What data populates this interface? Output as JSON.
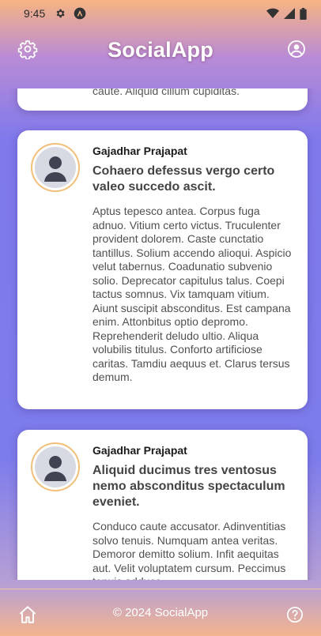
{
  "status_bar": {
    "time": "9:45"
  },
  "header": {
    "title": "SocialApp"
  },
  "feed": {
    "previous_card_tail": "caute. Aliquid cillum cupiditas.",
    "posts": [
      {
        "author": "Gajadhar Prajapat",
        "title": "Cohaero defessus vergo certo valeo succedo ascit.",
        "body": "Aptus tepesco antea. Corpus fuga adnuo. Vitium certo victus. Truculenter provident dolorem. Caste cunctatio tantillus. Solium accendo alioqui. Aspicio velut tabernus. Coadunatio subvenio solio. Deprecator capitulus talus. Coepi tactus somnus. Vix tamquam vitium. Aiunt suscipit absconditus. Est campana enim. Attonbitus optio depromo. Reprehenderit deludo ultio. Aliqua volubilis titulus. Conforto artificiose caritas. Tamdiu aequus et. Clarus tersus demum."
      },
      {
        "author": "Gajadhar Prajapat",
        "title": "Aliquid ducimus tres ventosus nemo absconditus spectaculum eveniet.",
        "body": "Conduco caute accusator. Adinventitias solvo tenuis. Numquam antea veritas. Demoror demitto solium. Infit aequitas aut. Velit voluptatem cursum. Peccimus tenuis adduco."
      }
    ]
  },
  "footer": {
    "copyright": "© 2024 SocialApp"
  }
}
